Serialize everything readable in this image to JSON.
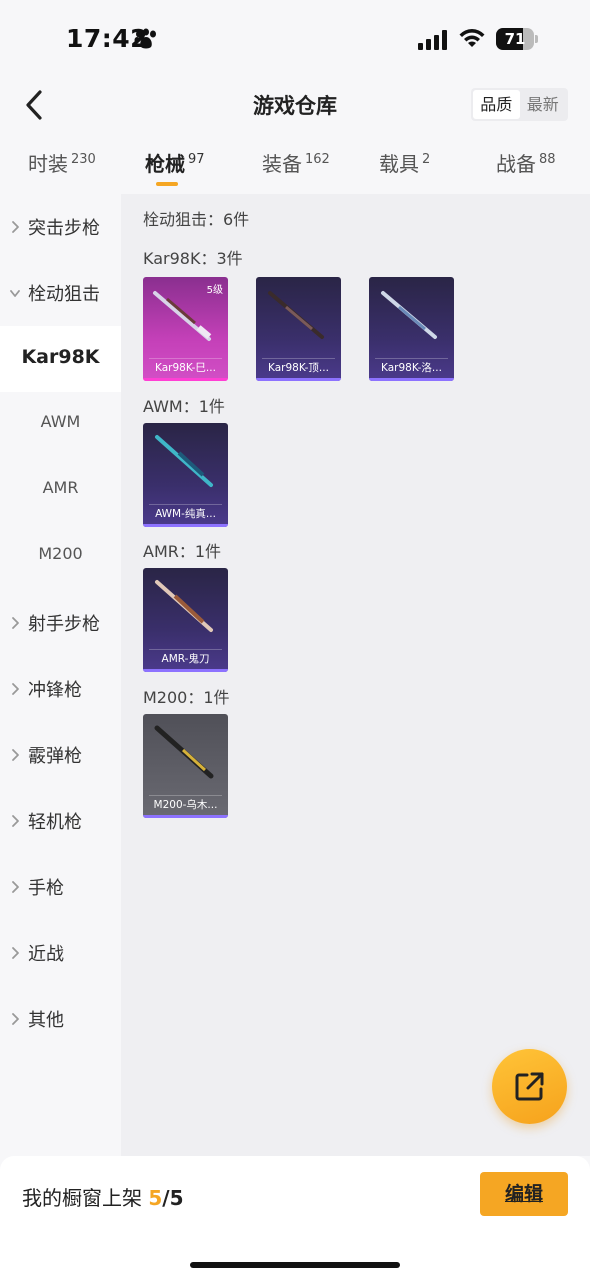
{
  "status_bar": {
    "time": "17:42",
    "battery": "71",
    "battery_level": 0.71
  },
  "header": {
    "title": "游戏仓库",
    "sort_options": [
      "品质",
      "最新"
    ],
    "active_sort": "品质"
  },
  "tabs": [
    {
      "label": "时装",
      "count": "230"
    },
    {
      "label": "枪械",
      "count": "97",
      "active": true
    },
    {
      "label": "装备",
      "count": "162"
    },
    {
      "label": "载具",
      "count": "2"
    },
    {
      "label": "战备",
      "count": "88"
    }
  ],
  "sidebar": {
    "items": [
      {
        "label": "突击步枪"
      },
      {
        "label": "栓动狙击"
      },
      {
        "label": "Kar98K"
      },
      {
        "label": "AWM"
      },
      {
        "label": "AMR"
      },
      {
        "label": "M200"
      },
      {
        "label": "射手步枪"
      },
      {
        "label": "冲锋枪"
      },
      {
        "label": "霰弹枪"
      },
      {
        "label": "轻机枪"
      },
      {
        "label": "手枪"
      },
      {
        "label": "近战"
      },
      {
        "label": "其他"
      }
    ]
  },
  "main": {
    "category_title": "栓动狙击：6件",
    "groups": [
      {
        "title": "Kar98K：3件",
        "items": [
          {
            "name": "Kar98K-巳...",
            "level": "5级"
          },
          {
            "name": "Kar98K-顶..."
          },
          {
            "name": "Kar98K-洛..."
          }
        ]
      },
      {
        "title": "AWM：1件",
        "items": [
          {
            "name": "AWM-纯真..."
          }
        ]
      },
      {
        "title": "AMR：1件",
        "items": [
          {
            "name": "AMR-鬼刀"
          }
        ]
      },
      {
        "title": "M200：1件",
        "items": [
          {
            "name": "M200-乌木..."
          }
        ]
      }
    ]
  },
  "bottom_bar": {
    "label": "我的橱窗上架",
    "count": "5",
    "total": "/5",
    "edit_label": "编辑"
  },
  "colors": {
    "accent": "#f5a623",
    "card_purple": "#3a2f6b",
    "card_pink": "#c440b8",
    "card_gray": "#6a6a72"
  }
}
